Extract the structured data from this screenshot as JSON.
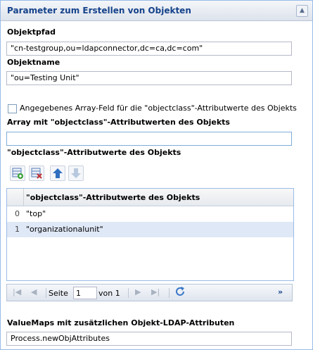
{
  "panel": {
    "title": "Parameter zum Erstellen von Objekten"
  },
  "fields": {
    "objektpfad_label": "Objektpfad",
    "objektpfad_value": "\"cn-testgroup,ou=ldapconnector,dc=ca,dc=com\"",
    "objektname_label": "Objektname",
    "objektname_value": "\"ou=Testing Unit\"",
    "checkbox_label": "Angegebenes Array-Feld für die \"objectclass\"-Attributwerte des Objekts",
    "array_label": "Array mit \"objectclass\"-Attributwerten des Objekts",
    "array_value": "",
    "attrwerte_label": "\"objectclass\"-Attributwerte des Objekts",
    "valuemaps_label": "ValueMaps mit zusätzlichen Objekt-LDAP-Attributen",
    "valuemaps_value": "Process.newObjAttributes"
  },
  "grid": {
    "column_header": "\"objectclass\"-Attributwerte des Objekts",
    "rows": [
      {
        "index": "0",
        "value": "\"top\""
      },
      {
        "index": "1",
        "value": "\"organizationalunit\""
      }
    ]
  },
  "pager": {
    "page_label": "Seite",
    "page_value": "1",
    "of_label": "von 1",
    "more": "»"
  },
  "icons": {
    "add": "add-row-icon",
    "remove": "remove-row-icon",
    "up": "move-up-icon",
    "down": "move-down-icon",
    "refresh": "refresh-icon"
  },
  "colors": {
    "header_title": "#15428b",
    "selected_row": "#dfe8f6",
    "border": "#99bbe8"
  }
}
